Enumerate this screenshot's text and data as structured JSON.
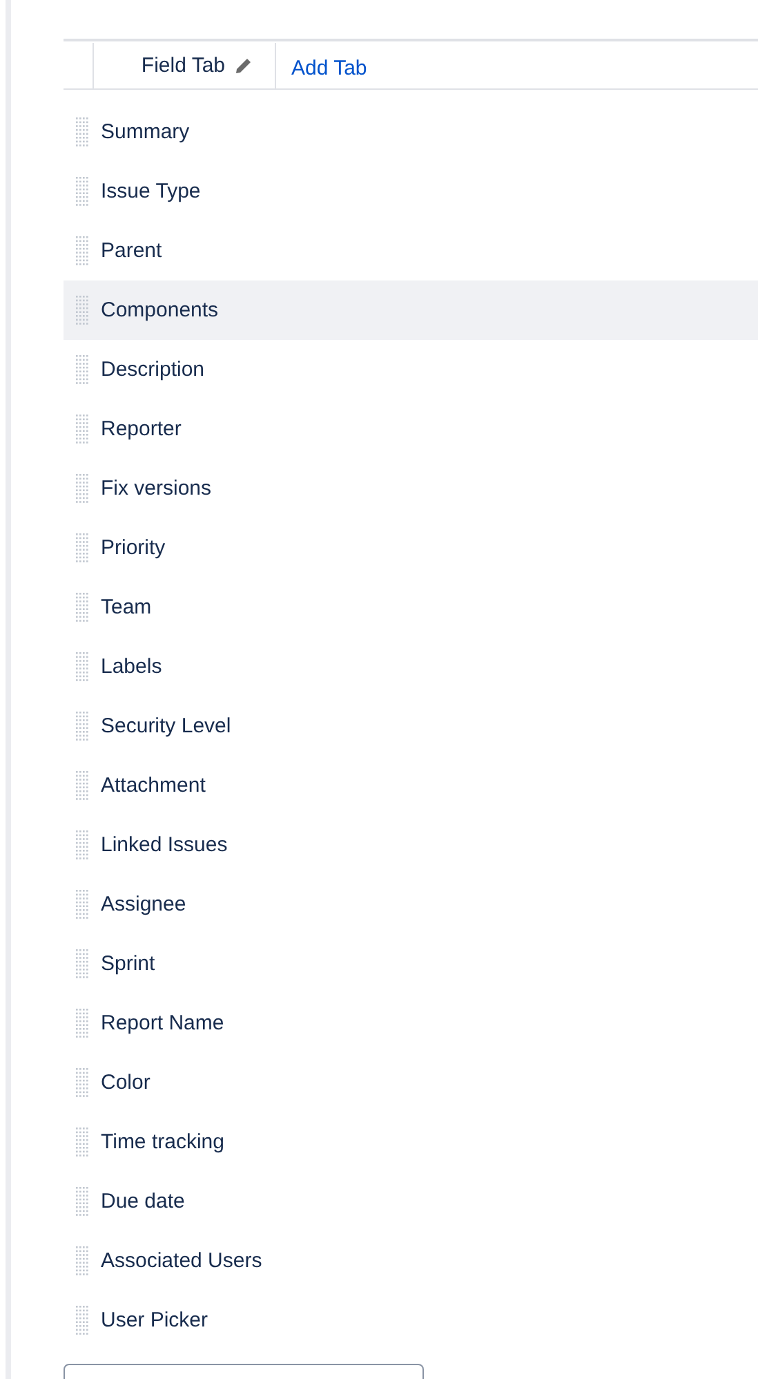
{
  "tabs": [
    {
      "label": "Field Tab",
      "selected": true,
      "kind": "tab"
    },
    {
      "label": "Add Tab",
      "selected": false,
      "kind": "link"
    }
  ],
  "fields": [
    {
      "label": "Summary",
      "hovered": false
    },
    {
      "label": "Issue Type",
      "hovered": false
    },
    {
      "label": "Parent",
      "hovered": false
    },
    {
      "label": "Components",
      "hovered": true
    },
    {
      "label": "Description",
      "hovered": false
    },
    {
      "label": "Reporter",
      "hovered": false
    },
    {
      "label": "Fix versions",
      "hovered": false
    },
    {
      "label": "Priority",
      "hovered": false
    },
    {
      "label": "Team",
      "hovered": false
    },
    {
      "label": "Labels",
      "hovered": false
    },
    {
      "label": "Security Level",
      "hovered": false
    },
    {
      "label": "Attachment",
      "hovered": false
    },
    {
      "label": "Linked Issues",
      "hovered": false
    },
    {
      "label": "Assignee",
      "hovered": false
    },
    {
      "label": "Sprint",
      "hovered": false
    },
    {
      "label": "Report Name",
      "hovered": false
    },
    {
      "label": "Color",
      "hovered": false
    },
    {
      "label": "Time tracking",
      "hovered": false
    },
    {
      "label": "Due date",
      "hovered": false
    },
    {
      "label": "Associated Users",
      "hovered": false
    },
    {
      "label": "User Picker",
      "hovered": false
    }
  ]
}
